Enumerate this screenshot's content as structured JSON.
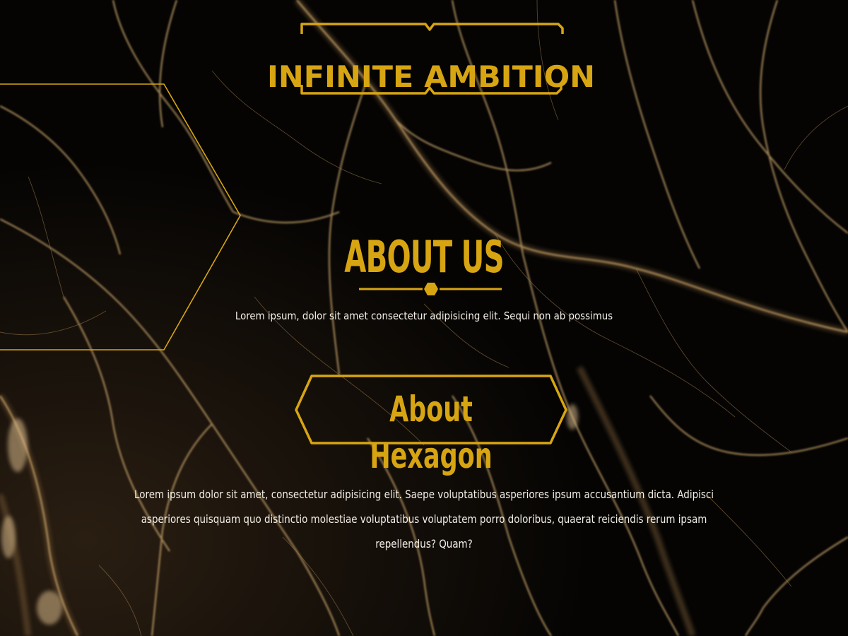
{
  "brand": {
    "logo_text": "INFINITE AMBITION",
    "accent_color": "#d8a512"
  },
  "about": {
    "title": "ABOUT US",
    "subtitle": "Lorem ipsum, dolor sit amet consectetur adipisicing elit. Sequi non ab possimus"
  },
  "hexagon_section": {
    "button_label": "About Hexagon",
    "paragraph": "Lorem ipsum dolor sit amet, consectetur adipisicing elit. Saepe voluptatibus asperiores ipsum accusantium dicta. Adipisci asperiores quisquam quo distinctio molestiae voluptatibus voluptatem porro doloribus, quaerat reiciendis rerum ipsam repellendus? Quam?"
  },
  "theme": {
    "background": "#050403",
    "marble_vein_color": "#c8a46a",
    "text_color": "#f4f0e8"
  }
}
